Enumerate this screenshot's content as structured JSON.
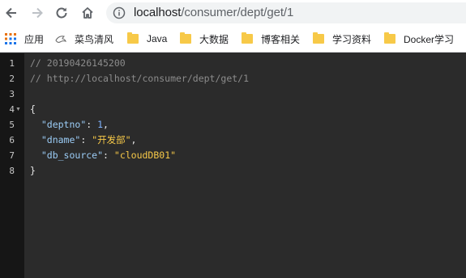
{
  "browser": {
    "url_host": "localhost",
    "url_path": "/consumer/dept/get/1"
  },
  "bookmarks": [
    {
      "label": "应用",
      "icon": "apps-grid-icon"
    },
    {
      "label": "菜鸟清风",
      "icon": "bird-logo-icon"
    },
    {
      "label": "Java",
      "icon": "folder-icon"
    },
    {
      "label": "大数据",
      "icon": "folder-icon"
    },
    {
      "label": "博客相关",
      "icon": "folder-icon"
    },
    {
      "label": "学习资料",
      "icon": "folder-icon"
    },
    {
      "label": "Docker学习",
      "icon": "folder-icon"
    }
  ],
  "code": {
    "line_numbers": [
      "1",
      "2",
      "3",
      "4",
      "5",
      "6",
      "7",
      "8"
    ],
    "comment_time": "// 20190426145200",
    "comment_url": "// http://localhost/consumer/dept/get/1",
    "open_brace": "{",
    "close_brace": "}",
    "fields": [
      {
        "key": "\"deptno\"",
        "value": "1",
        "suffix": ","
      },
      {
        "key": "\"dname\"",
        "value": "\"开发部\"",
        "suffix": ","
      },
      {
        "key": "\"db_source\"",
        "value": "\"cloudDB01\"",
        "suffix": ""
      }
    ]
  },
  "colors": {
    "editor_bg": "#2b2b2b",
    "gutter_bg": "#161616",
    "key": "#9ccdf7",
    "string": "#f7c948",
    "number": "#7fb3ff",
    "comment": "#8c8c8c"
  }
}
